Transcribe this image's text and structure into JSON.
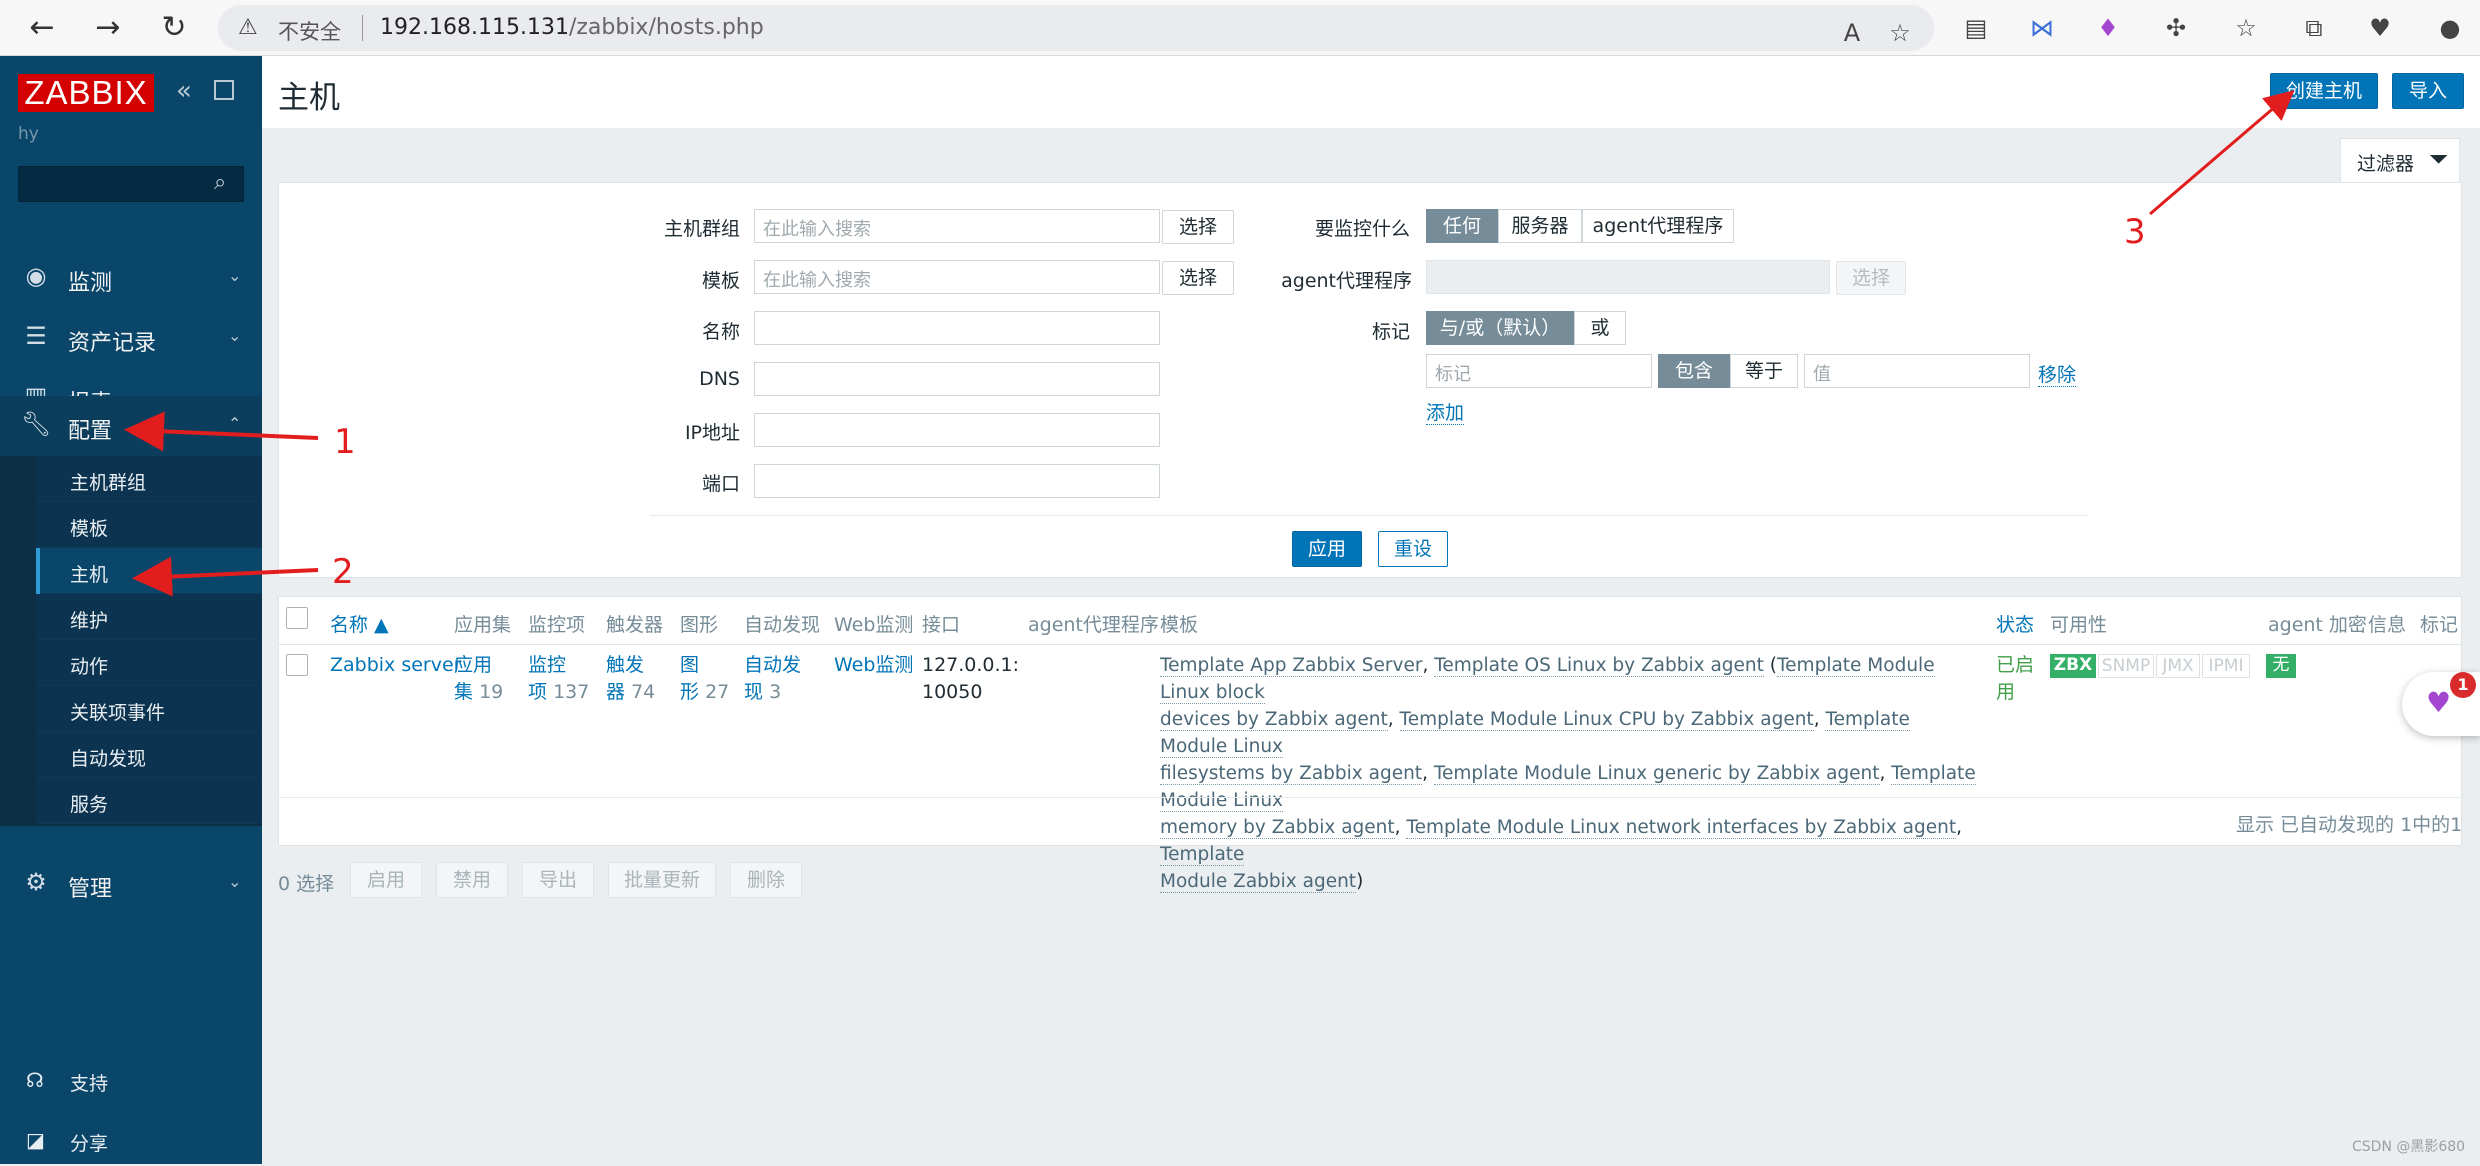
{
  "browser": {
    "back": "←",
    "forward": "→",
    "reload": "↻",
    "security_warning": "不安全",
    "url_host": "192.168.115.131",
    "url_path": "/zabbix/hosts.php"
  },
  "sidebar": {
    "logo": "ZABBIX",
    "user": "hy",
    "search_placeholder": "",
    "menu": [
      {
        "label": "监测",
        "icon": "eye-icon"
      },
      {
        "label": "资产记录",
        "icon": "list-icon"
      },
      {
        "label": "报表",
        "icon": "bar-chart-icon"
      },
      {
        "label": "配置",
        "icon": "wrench-icon"
      },
      {
        "label": "管理",
        "icon": "gear-icon"
      }
    ],
    "config_items": [
      "主机群组",
      "模板",
      "主机",
      "维护",
      "动作",
      "关联项事件",
      "自动发现",
      "服务"
    ],
    "bottom": [
      {
        "label": "支持",
        "icon": "headset-icon"
      },
      {
        "label": "分享",
        "icon": "share-icon"
      }
    ]
  },
  "header": {
    "title": "主机",
    "create_button": "创建主机",
    "import_button": "导入"
  },
  "filter": {
    "tab_label": "过滤器",
    "host_groups_label": "主机群组",
    "templates_label": "模板",
    "name_label": "名称",
    "dns_label": "DNS",
    "ip_label": "IP地址",
    "port_label": "端口",
    "search_placeholder": "在此输入搜索",
    "select_button": "选择",
    "monitored_by_label": "要监控什么",
    "monitored_by_options": [
      "任何",
      "服务器",
      "agent代理程序"
    ],
    "proxy_label": "agent代理程序",
    "tags_label": "标记",
    "tags_operator": [
      "与/或（默认）",
      "或"
    ],
    "tag_placeholder": "标记",
    "tag_match": [
      "包含",
      "等于"
    ],
    "value_placeholder": "值",
    "remove_link": "移除",
    "add_link": "添加",
    "apply_button": "应用",
    "reset_button": "重设"
  },
  "table": {
    "headers": [
      "名称 ▲",
      "应用集",
      "监控项",
      "触发器",
      "图形",
      "自动发现",
      "Web监测",
      "接口",
      "agent代理程序",
      "模板",
      "状态",
      "可用性",
      "agent 加密",
      "信息",
      "标记"
    ],
    "row": {
      "name": "Zabbix server",
      "apps_label": [
        "应用",
        "集"
      ],
      "apps_count": "19",
      "items_label": [
        "监控",
        "项"
      ],
      "items_count": "137",
      "triggers_label": [
        "触发",
        "器"
      ],
      "triggers_count": "74",
      "graphs_label": [
        "图",
        "形"
      ],
      "graphs_count": "27",
      "discovery_label": [
        "自动发",
        "现"
      ],
      "discovery_count": "3",
      "web_label": "Web监测",
      "interface": [
        "127.0.0.1:",
        "10050"
      ],
      "templates_line1_a": "Template App Zabbix Server",
      "templates_line1_b": "Template OS Linux by Zabbix agent",
      "templates_line1_c": "Template Module Linux block",
      "templates_line2_a": "devices by Zabbix agent",
      "templates_line2_b": "Template Module Linux CPU by Zabbix agent",
      "templates_line2_c": "Template Module Linux",
      "templates_line3_a": "filesystems by Zabbix agent",
      "templates_line3_b": "Template Module Linux generic by Zabbix agent",
      "templates_line3_c": "Template Module Linux",
      "templates_line4_a": "memory by Zabbix agent",
      "templates_line4_b": "Template Module Linux network interfaces by Zabbix agent",
      "templates_line4_c": "Template",
      "templates_line5_a": "Module Zabbix agent",
      "status": [
        "已启",
        "用"
      ],
      "availability": [
        "ZBX",
        "SNMP",
        "JMX",
        "IPMI"
      ],
      "encryption": "无"
    },
    "footer": "显示 已自动发现的 1中的1"
  },
  "actions": {
    "selected": "0 选择",
    "buttons": [
      "启用",
      "禁用",
      "导出",
      "批量更新",
      "删除"
    ]
  },
  "annotations": [
    "1",
    "2",
    "3"
  ],
  "widget_badge": "1",
  "watermark": "CSDN @黑影680",
  "colors": {
    "sidebar": "#0a466a",
    "accent": "#0275b8",
    "logo": "#d40000",
    "annotation": "#e21d1d",
    "green": "#34af67"
  }
}
